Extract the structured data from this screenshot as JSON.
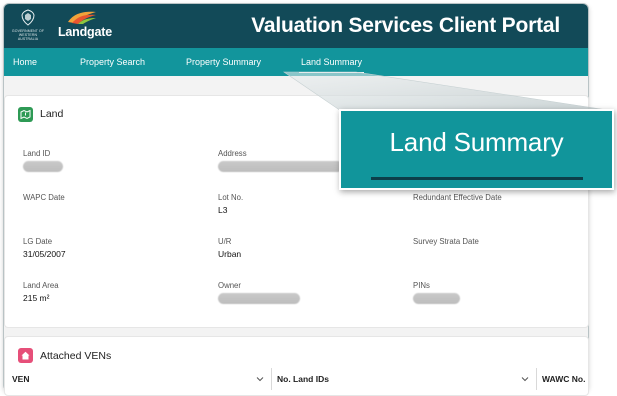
{
  "header": {
    "crest_text": "GOVERNMENT OF WESTERN AUSTRALIA",
    "brand": "Landgate",
    "title": "Valuation Services Client Portal"
  },
  "nav": {
    "items": [
      {
        "label": "Home"
      },
      {
        "label": "Property Search"
      },
      {
        "label": "Property Summary"
      },
      {
        "label": "Land Summary"
      }
    ],
    "active_index": 3
  },
  "land_card": {
    "title": "Land",
    "icon": "land-icon",
    "fields": {
      "land_id": {
        "label": "Land ID"
      },
      "address": {
        "label": "Address"
      },
      "wapc_date": {
        "label": "WAPC Date"
      },
      "lot_no": {
        "label": "Lot No.",
        "value": "L3"
      },
      "redundant_effective_date": {
        "label": "Redundant Effective Date"
      },
      "lg_date": {
        "label": "LG Date",
        "value": "31/05/2007"
      },
      "ur": {
        "label": "U/R",
        "value": "Urban"
      },
      "survey_strata_date": {
        "label": "Survey Strata Date"
      },
      "land_area": {
        "label": "Land Area",
        "value": "215 m²"
      },
      "owner": {
        "label": "Owner"
      },
      "pins": {
        "label": "PINs"
      }
    }
  },
  "vens_card": {
    "title": "Attached VENs",
    "icon": "home-icon",
    "columns": [
      {
        "label": "VEN"
      },
      {
        "label": "No. Land IDs"
      },
      {
        "label": "WAWC No."
      }
    ]
  },
  "callout": {
    "text": "Land Summary"
  },
  "colors": {
    "header": "#124a58",
    "nav": "#12959c",
    "callout": "#11959b",
    "land_icon": "#2e9a55",
    "home_icon": "#e64f79"
  }
}
